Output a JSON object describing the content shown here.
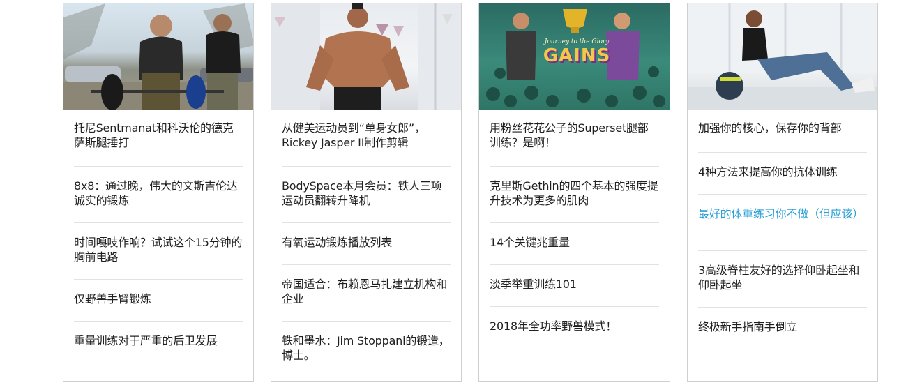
{
  "cards": [
    {
      "image_alt": "托尼Sentmanat和科沃伦",
      "items": [
        "托尼Sentmanat和科沃伦的德克萨斯腿捶打",
        "8x8：通过晚，伟大的文斯吉伦达诚实的锻炼",
        "时间嘎吱作响？试试这个15分钟的胸前电路",
        "仅野兽手臂锻炼",
        "重量训练对于严重的后卫发展"
      ]
    },
    {
      "image_alt": "Rickey Jasper II",
      "items": [
        "从健美运动员到“单身女郎”，Rickey Jasper II制作剪辑",
        "BodySpace本月会员：铁人三项运动员翻转升降机",
        "有氧运动锻炼播放列表",
        "帝国适合：布赖恩马扎建立机构和企业",
        "铁和墨水：Jim Stoppani的锻造，博士。"
      ]
    },
    {
      "image_alt": "Journey to Glory Gains",
      "image_text_top": "Journey to the Glory",
      "image_text_main": "GAINS",
      "items": [
        "用粉丝花花公子的Superset腿部训练？是啊！",
        "克里斯Gethin的四个基本的强度提升技术为更多的肌肉",
        "14个关键兆重量",
        "淡季举重训练101",
        "2018年全功率野兽模式！"
      ]
    },
    {
      "image_alt": "核心训练",
      "items": [
        "加强你的核心，保存你的背部",
        "4种方法来提高你的抗体训练",
        "最好的体重练习你不做（但应该）",
        "3高级脊柱友好的选择仰卧起坐和仰卧起坐",
        "终极新手指南手倒立"
      ]
    }
  ],
  "colors": {
    "link_highlight": "#2ba0d8",
    "border": "#cfcfcf",
    "text": "#1f1f1f"
  }
}
